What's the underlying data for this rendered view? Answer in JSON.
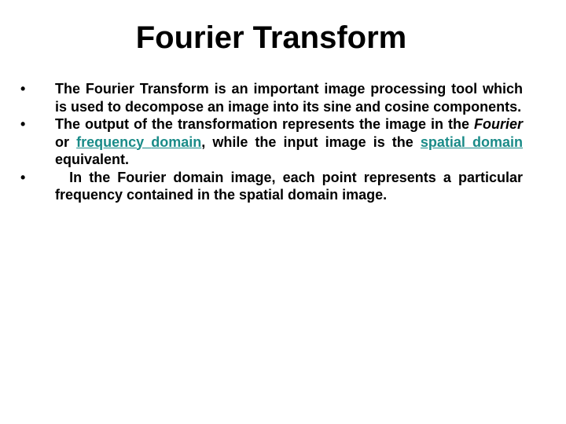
{
  "slide": {
    "title": "Fourier Transform",
    "bullet_glyph": "•",
    "bullets": [
      {
        "text": "The Fourier Transform is an important image processing tool which is used to decompose an image into its sine and cosine components."
      },
      {
        "part1": "The output of the transformation represents the image in the ",
        "italic": "Fourier",
        "part2": " or ",
        "link1": "frequency ",
        "part3": " ",
        "link2": "domain",
        "part4": ", while the input image is the ",
        "link3": "spatial domain",
        "part5": " equivalent."
      },
      {
        "text": "  In the Fourier domain image, each point represents a particular frequency contained in the spatial domain image."
      }
    ],
    "link_color": "#1a8b88"
  }
}
